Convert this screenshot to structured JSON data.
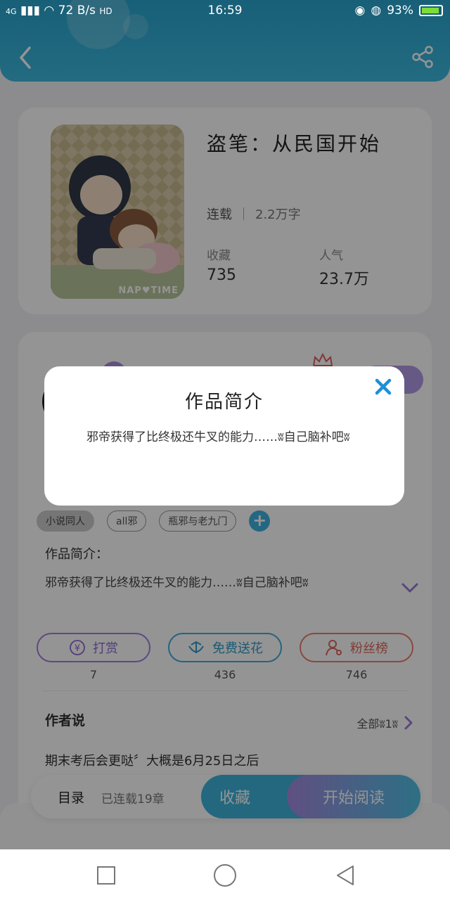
{
  "status_bar": {
    "network": "4G",
    "speed": "72 B/s",
    "hd": "HD",
    "time": "16:59",
    "battery": "93%"
  },
  "book": {
    "title": "盗笔：从民国开始",
    "status": "连载",
    "word_count": "2.2万字",
    "favorites_label": "收藏",
    "favorites_value": "735",
    "popularity_label": "人气",
    "popularity_value": "23.7万",
    "cover_text": "NAP♥TIME"
  },
  "tags": [
    "小说同人",
    "all邪",
    "瓶邪与老九门"
  ],
  "intro": {
    "heading": "作品简介：",
    "text": "邪帝获得了比终极还牛叉的能力……ʬ自己脑补吧ʬ"
  },
  "actions": [
    {
      "label": "打赏",
      "count": "7",
      "icon": "yen-icon"
    },
    {
      "label": "免费送花",
      "count": "436",
      "icon": "flower-icon"
    },
    {
      "label": "粉丝榜",
      "count": "746",
      "icon": "user-icon"
    }
  ],
  "author": {
    "heading": "作者说",
    "all_label": "全部ʬ1ʬ",
    "text": "期末考后会更哒〞大概是6月25日之后"
  },
  "bottom_bar": {
    "toc_label": "目录",
    "serial_label": "已连载19章",
    "collect_label": "收藏",
    "read_label": "开始阅读"
  },
  "modal": {
    "title": "作品简介",
    "body": "邪帝获得了比终极还牛叉的能力……ʬ自己脑补吧ʬ"
  },
  "colors": {
    "header_blue": "#2aa5cf",
    "accent_purple": "#a57de0",
    "accent_blue": "#3eadd8",
    "accent_red": "#ec7d72",
    "close_blue": "#1e90d8"
  }
}
